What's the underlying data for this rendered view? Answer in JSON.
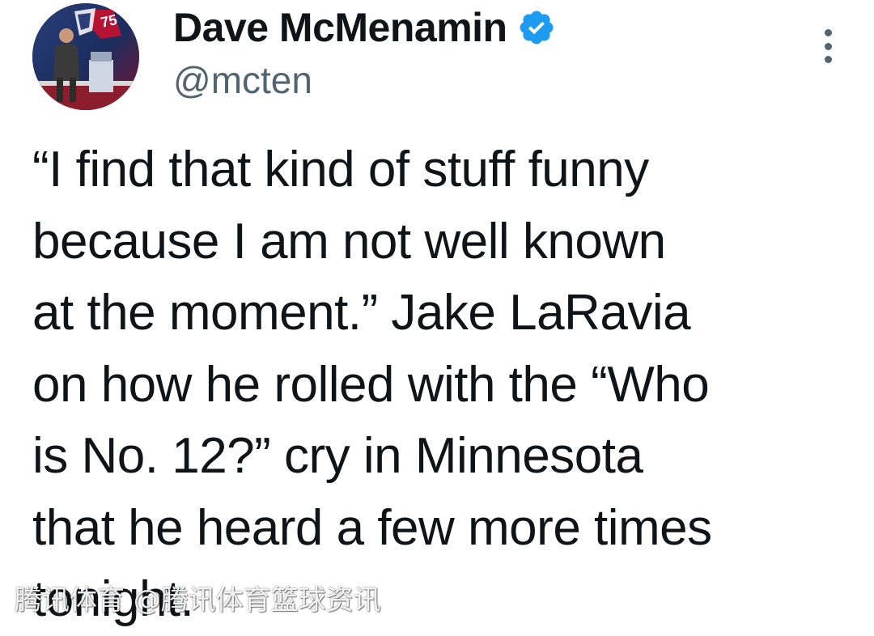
{
  "author": {
    "display_name": "Dave McMenamin",
    "handle": "@mcten",
    "verified": true,
    "avatar_badge": "75",
    "avatar_icon": "profile-photo",
    "verified_color": "#1d9bf0"
  },
  "tweet": {
    "text": "“I find that kind of stuff funny\nbecause I am not well known\nat the moment.” Jake LaRavia\non how he rolled with the “Who\nis No. 12?” cry in Minnesota\nthat he heard a few more times\ntonight."
  },
  "menu": {
    "icon": "more-vertical-icon"
  },
  "watermark": {
    "text": "腾讯体育 @腾讯体育篮球资讯"
  },
  "colors": {
    "text": "#0f1419",
    "secondary": "#536471",
    "background": "#ffffff"
  }
}
